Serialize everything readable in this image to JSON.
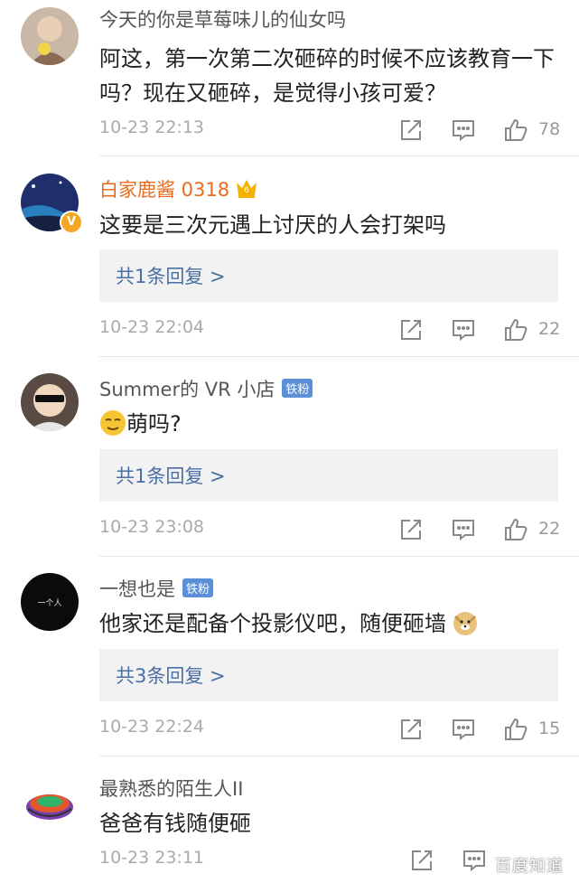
{
  "comments": [
    {
      "username": "今天的你是草莓味儿的仙女吗",
      "text": "阿这，第一次第二次砸碎的时候不应该教育一下吗？现在又砸碎，是觉得小孩可爱？",
      "time": "10-23 22:13",
      "likes": "78"
    },
    {
      "username": "白家鹿酱 0318",
      "text": "这要是三次元遇上讨厌的人会打架吗",
      "reply_label": "共1条回复 >",
      "time": "10-23 22:04",
      "likes": "22",
      "verified_badge": "V",
      "crown_number": "6"
    },
    {
      "username": "Summer的 VR 小店",
      "fan_badge": "铁粉",
      "text": "萌吗?",
      "reply_label": "共1条回复 >",
      "time": "10-23 23:08",
      "likes": "22"
    },
    {
      "username": "一想也是",
      "fan_badge": "铁粉",
      "text": "他家还是配备个投影仪吧，随便砸墙",
      "reply_label": "共3条回复 >",
      "time": "10-23 22:24",
      "likes": "15",
      "avatar_text": "一个人"
    },
    {
      "username": "最熟悉的陌生人II",
      "text": "爸爸有钱随便砸",
      "time": "10-23 23:11"
    }
  ],
  "watermark": "百度知道",
  "colors": {
    "vip_name": "#e86c1f",
    "reply_link": "#4a6fa5",
    "fan_badge": "#5b8fd8"
  }
}
